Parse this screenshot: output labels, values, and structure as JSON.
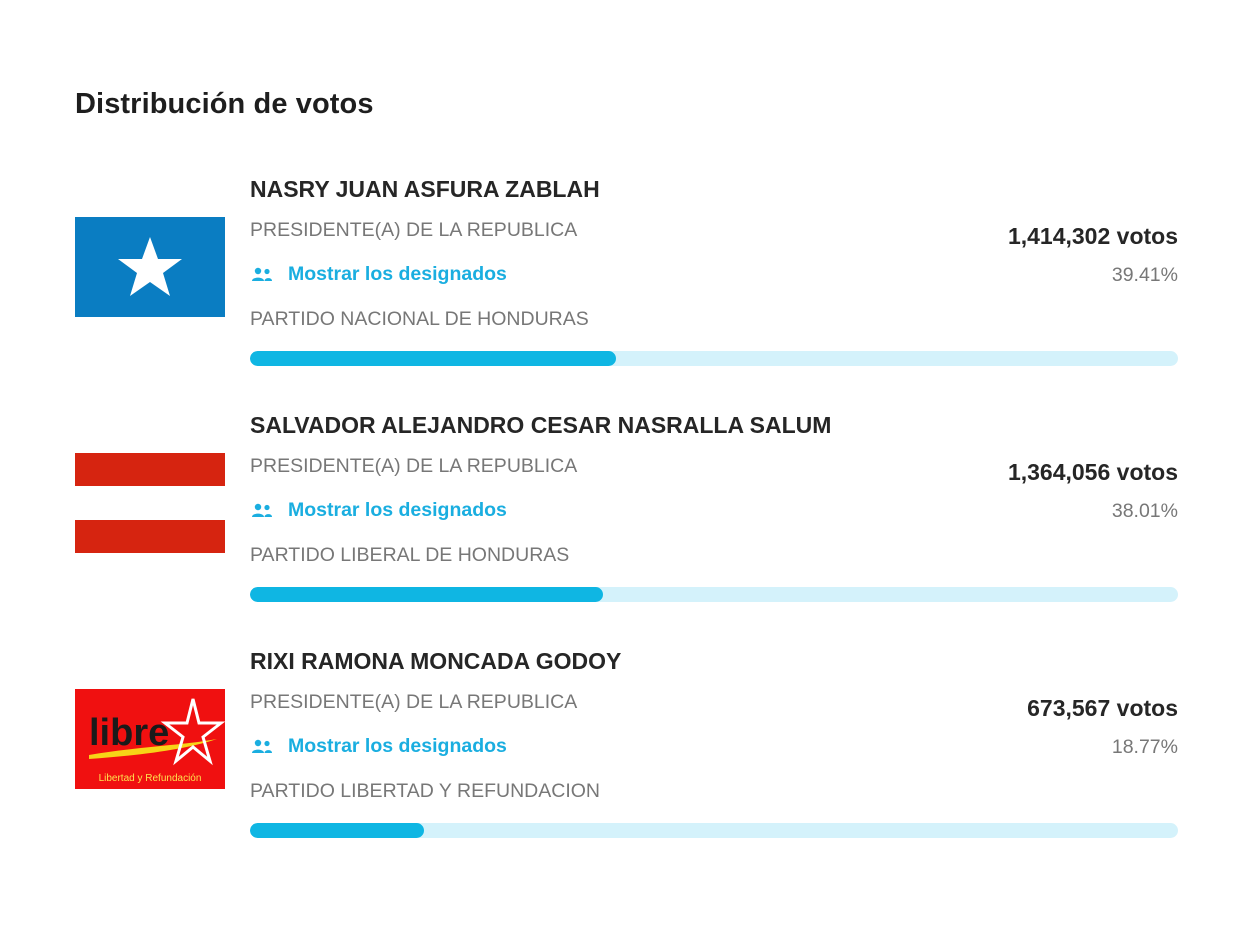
{
  "page": {
    "title": "Distribución de votos"
  },
  "colors": {
    "accent": "#1aaee0",
    "bar_fill": "#0fb6e3",
    "bar_track": "#d4f2fb",
    "nacional_blue": "#0a7dc2",
    "liberal_red": "#d62410",
    "libre_red": "#f01010"
  },
  "candidates": [
    {
      "name": "NASRY JUAN ASFURA ZABLAH",
      "position": "PRESIDENTE(A) DE LA REPUBLICA",
      "designados_label": "Mostrar los designados",
      "party": "PARTIDO NACIONAL DE HONDURAS",
      "votes": "1,414,302 votos",
      "percent": "39.41%",
      "percent_value": 39.41,
      "logo": "star-flag-icon"
    },
    {
      "name": "SALVADOR ALEJANDRO CESAR NASRALLA SALUM",
      "position": "PRESIDENTE(A) DE LA REPUBLICA",
      "designados_label": "Mostrar los designados",
      "party": "PARTIDO LIBERAL DE HONDURAS",
      "votes": "1,364,056 votos",
      "percent": "38.01%",
      "percent_value": 38.01,
      "logo": "striped-flag-icon"
    },
    {
      "name": "RIXI RAMONA MONCADA GODOY",
      "position": "PRESIDENTE(A) DE LA REPUBLICA",
      "designados_label": "Mostrar los designados",
      "party": "PARTIDO LIBERTAD Y REFUNDACION",
      "votes": "673,567 votos",
      "percent": "18.77%",
      "percent_value": 18.77,
      "logo": "libre-logo",
      "logo_text": "libre",
      "logo_subtext": "Libertad y Refundación"
    }
  ]
}
